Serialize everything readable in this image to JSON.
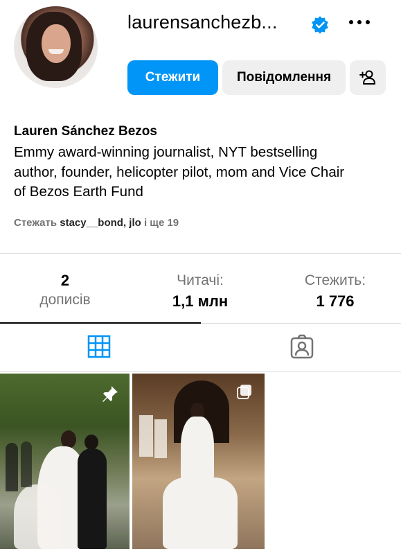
{
  "profile": {
    "username": "laurensanchezb...",
    "full_name": "Lauren Sánchez Bezos",
    "bio_lines": [
      "Emmy award-winning journalist, NYT bestselling",
      "author, founder, helicopter pilot, mom and Vice Chair",
      "of Bezos Earth Fund"
    ],
    "followed_by": {
      "prefix": "Стежать",
      "user1": "stacy__bond",
      "separator": ",",
      "user2": "jlo",
      "suffix": "і ще 19"
    }
  },
  "actions": {
    "follow_label": "Стежити",
    "message_label": "Повідомлення"
  },
  "stats": {
    "posts_count": "2",
    "posts_label": "дописів",
    "followers_label": "Читачі:",
    "followers_count": "1,1 млн",
    "following_label": "Стежить:",
    "following_count": "1 776"
  },
  "tabs": [
    {
      "icon": "grid-icon",
      "active": true
    },
    {
      "icon": "tagged-icon",
      "active": false
    }
  ],
  "posts": [
    {
      "badge_icon": "pin-icon"
    },
    {
      "badge_icon": "multiple-photos-icon"
    }
  ],
  "colors": {
    "primary": "#0095f6",
    "secondary_button": "#efefef",
    "muted_text": "#737373",
    "verified": "#0095f6"
  }
}
